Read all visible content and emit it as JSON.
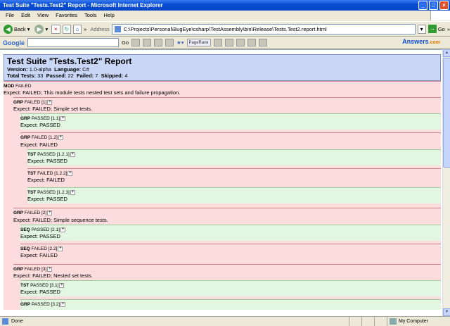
{
  "window": {
    "title": "Test Suite \"Tests.Test2\" Report - Microsoft Internet Explorer"
  },
  "menu": [
    "File",
    "Edit",
    "View",
    "Favorites",
    "Tools",
    "Help"
  ],
  "toolbar": {
    "back_label": "Back",
    "address_label": "Address",
    "address_value": "C:\\Projects\\Personal\\BugEye\\csharp\\TestAssembly\\bin\\Release\\Tests.Test2.report.html",
    "go_label": "Go"
  },
  "googlebar": {
    "logo": "Google",
    "go_label": "Go",
    "pagerank": "PageRank",
    "answers": "Answers",
    "answers_suffix": ".com"
  },
  "report": {
    "title": "Test Suite \"Tests.Test2\" Report",
    "version_label": "Version:",
    "version": "1.0-alpha",
    "language_label": "Language:",
    "language": "C#",
    "total_label": "Total Tests:",
    "total": "33",
    "passed_label": "Passed:",
    "passed": "22",
    "failed_label": "Failed:",
    "failed": "7",
    "skipped_label": "Skipped:",
    "skipped": "4",
    "mod": {
      "tag": "MOD",
      "status": "FAILED",
      "expect": "Expect: FAILED; This module tests nested test sets and failure propagation."
    },
    "rows": [
      {
        "tag": "GRP",
        "status": "FAILED [1]",
        "expect": "Expect: FAILED; Simple set tests."
      },
      {
        "tag": "GRP",
        "status": "PASSED [1.1]",
        "expect": "Expect: PASSED"
      },
      {
        "tag": "GRP",
        "status": "FAILED [1.2]",
        "expect": "Expect: FAILED"
      },
      {
        "tag": "TST",
        "status": "PASSED [1.2.1]",
        "expect": "Expect: PASSED"
      },
      {
        "tag": "TST",
        "status": "FAILED [1.2.2]",
        "expect": "Expect: FAILED"
      },
      {
        "tag": "TST",
        "status": "PASSED [1.2.3]",
        "expect": "Expect: PASSED"
      },
      {
        "tag": "GRP",
        "status": "FAILED [2]",
        "expect": "Expect: FAILED; Simple sequence tests."
      },
      {
        "tag": "SEQ",
        "status": "PASSED [2.1]",
        "expect": "Expect: PASSED"
      },
      {
        "tag": "SEQ",
        "status": "FAILED [2.2]",
        "expect": "Expect: FAILED"
      },
      {
        "tag": "GRP",
        "status": "FAILED [3]",
        "expect": "Expect: FAILED; Nested set tests."
      },
      {
        "tag": "TST",
        "status": "PASSED [3.1]",
        "expect": "Expect: PASSED"
      },
      {
        "tag": "GRP",
        "status": "PASSED [3.2]",
        "expect": ""
      }
    ]
  },
  "status": {
    "text": "Done",
    "zone": "My Computer"
  },
  "colors": {
    "fail_bg": "#fcdcdc",
    "pass_bg": "#e2f6e2",
    "header_bg": "#c9d6f5"
  }
}
